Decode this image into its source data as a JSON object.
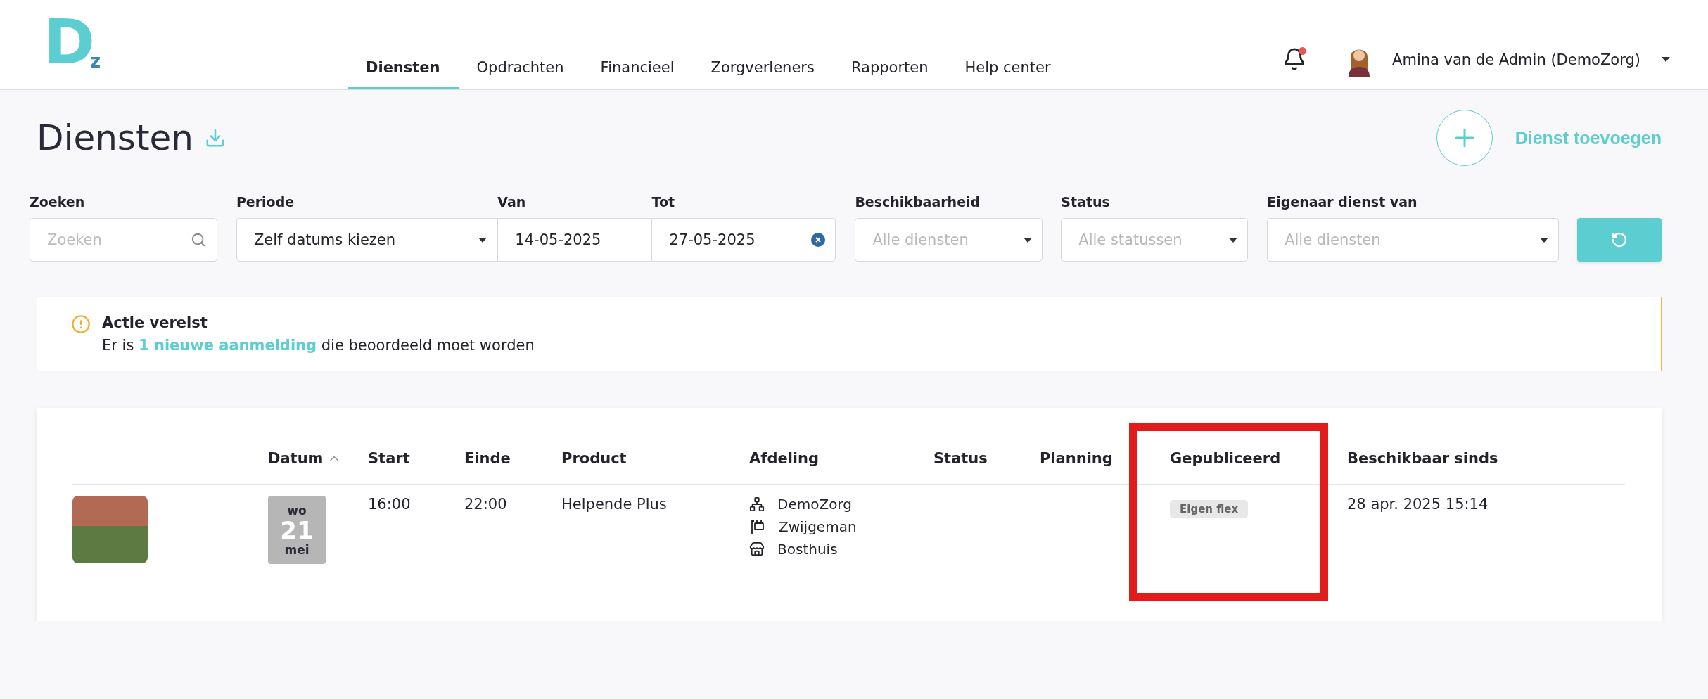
{
  "logo": {
    "main": "D",
    "sub": "z"
  },
  "nav": [
    {
      "label": "Diensten",
      "selected": true
    },
    {
      "label": "Opdrachten",
      "selected": false
    },
    {
      "label": "Financieel",
      "selected": false
    },
    {
      "label": "Zorgverleners",
      "selected": false
    },
    {
      "label": "Rapporten",
      "selected": false
    },
    {
      "label": "Help center",
      "selected": false
    }
  ],
  "notifications": {
    "unread": true
  },
  "user": {
    "name": "Amina van de Admin (DemoZorg)"
  },
  "page": {
    "title": "Diensten",
    "add_label": "Dienst toevoegen"
  },
  "filters": [
    {
      "kind": "search",
      "label": "Zoeken",
      "placeholder": "Zoeken"
    },
    {
      "kind": "select",
      "label": "Periode",
      "value": "Zelf datums kiezen"
    },
    {
      "kind": "date",
      "label": "Van",
      "value": "14-05-2025"
    },
    {
      "kind": "date-clear",
      "label": "Tot",
      "value": "27-05-2025"
    },
    {
      "kind": "select",
      "label": "Beschikbaarheid",
      "placeholder": "Alle diensten"
    },
    {
      "kind": "select",
      "label": "Status",
      "placeholder": "Alle statussen"
    },
    {
      "kind": "select",
      "label": "Eigenaar dienst van",
      "placeholder": "Alle diensten"
    }
  ],
  "alert": {
    "title": "Actie vereist",
    "message": "Er is ",
    "link": "1 nieuwe aanmelding",
    "message_end": " die beoordeeld moet worden"
  },
  "table": {
    "columns": [
      {
        "sorted": false,
        "highlighted": false
      },
      {
        "label": "Datum",
        "sorted": true,
        "highlighted": false
      },
      {
        "label": "Start",
        "sorted": false,
        "highlighted": false
      },
      {
        "label": "Einde",
        "sorted": false,
        "highlighted": false
      },
      {
        "label": "Product",
        "sorted": false,
        "highlighted": false
      },
      {
        "label": "Afdeling",
        "sorted": false,
        "highlighted": false
      },
      {
        "label": "Status",
        "sorted": false,
        "highlighted": false
      },
      {
        "label": "Planning",
        "sorted": false,
        "highlighted": false
      },
      {
        "label": "Gepubliceerd",
        "sorted": false,
        "highlighted": true
      },
      {
        "label": "Beschikbaar sinds",
        "sorted": false,
        "highlighted": false
      }
    ],
    "rows": [
      {
        "date": {
          "weekday": "wo",
          "day": "21",
          "month": "mei"
        },
        "start": "16:00",
        "end": "22:00",
        "product": "Helpende Plus",
        "department": [
          {
            "kind": "organisation",
            "text": "DemoZorg"
          },
          {
            "kind": "location",
            "text": "Zwijgeman"
          },
          {
            "kind": "building",
            "text": "Bosthuis"
          }
        ],
        "published": "Eigen flex",
        "available_since": "28 apr. 2025 15:14"
      }
    ]
  }
}
